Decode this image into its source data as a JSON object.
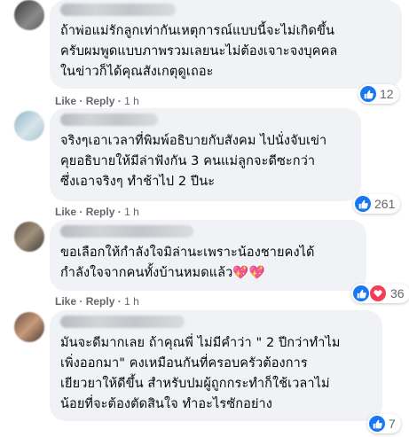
{
  "comments": [
    {
      "text": "ถ้าพ่อแม่รักลูกเท่ากันเหตุการณ์แบบนี้จะไม่เกิดขึ้น\nครับผมพูดแบบภาพรวมเลยนะไม่ต้องเจาะจงบุคคล\nในข่าวก็ได้คุณสังเกตุดูเถอะ",
      "like": "Like",
      "reply": "Reply",
      "time": "1 h",
      "reaction_count": "12",
      "reactions": [
        "like"
      ]
    },
    {
      "text": "จริงๆเอาเวลาที่พิมพ์อธิบายกับสังคม ไปนั่งจับเข่า\nคุยอธิบายให้มีล่าฟังกัน 3 คนแม่ลูกจะดีซะกว่า\nซึ่งเอาจริงๆ ทำช้าไป 2 ปีนะ",
      "like": "Like",
      "reply": "Reply",
      "time": "1 h",
      "reaction_count": "261",
      "reactions": [
        "like"
      ]
    },
    {
      "text": "ขอเลือกให้กำลังใจมิล่านะเพราะน้องชายคงได้\nกำลังใจจากคนทั้งบ้านหมดแล้ว💖💖",
      "like": "Like",
      "reply": "Reply",
      "time": "1 h",
      "reaction_count": "36",
      "reactions": [
        "like",
        "love"
      ]
    },
    {
      "text": "มันจะดีมากเลย ถ้าคุณพี่ ไม่มีคำว่า \" 2 ปีกว่าทำไม\nเพิ่งออกมา\" คงเหมือนกันที่ครอบครัวต้องการ\nเยียวยาให้ดีขึ้น สำหรับปมผู้ถูกกระทำก็ใช้เวลาไม่\nน้อยที่จะต้องตัดสินใจ ทำอะไรซักอย่าง",
      "like": "Like",
      "reply": "Reply",
      "time": "1 h",
      "reaction_count": "7",
      "reactions": [
        "like"
      ]
    }
  ],
  "colors": {
    "bubble": "#f0f2f5",
    "meta_text": "#65676b",
    "like_blue": "#1877f2",
    "love_red": "#f33e58"
  }
}
